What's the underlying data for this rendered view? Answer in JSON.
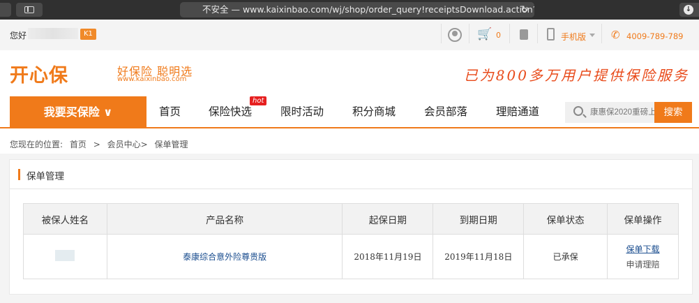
{
  "browser": {
    "url": "不安全 — www.kaixinbao.com/wj/shop/order_query!receiptsDownload.action?c"
  },
  "topbar": {
    "greeting": "您好",
    "level_badge": "K1",
    "cart_count": "0",
    "mobile_label": "手机版",
    "phone": "4009-789-789"
  },
  "header": {
    "logo": "开心保",
    "slogan": "好保险 聪明选",
    "site": "www.kaixinbao.com",
    "tagline": "已为800多万用户提供保险服务"
  },
  "nav": {
    "buy_button": "我要买保险 ∨",
    "items": [
      "首页",
      "保险快选",
      "限时活动",
      "积分商城",
      "会员部落",
      "理赔通道"
    ],
    "hot_badge": "hot",
    "search_placeholder": "康惠保2020重磅上",
    "search_button": "搜索"
  },
  "breadcrumb": {
    "prefix": "您现在的位置:",
    "items": [
      "首页",
      ">",
      "会员中心>",
      "保单管理"
    ]
  },
  "panel": {
    "title": "保单管理",
    "table": {
      "headers": [
        "被保人姓名",
        "产品名称",
        "起保日期",
        "到期日期",
        "保单状态",
        "保单操作"
      ],
      "rows": [
        {
          "name": "",
          "product": "泰康综合意外险尊贵版",
          "start": "2018年11月19日",
          "end": "2019年11月18日",
          "status": "已承保",
          "action_download": "保单下载",
          "action_claim": "申请理赔"
        }
      ]
    }
  },
  "colors": {
    "accent": "#f07a1a",
    "link": "#1a4d8f"
  }
}
